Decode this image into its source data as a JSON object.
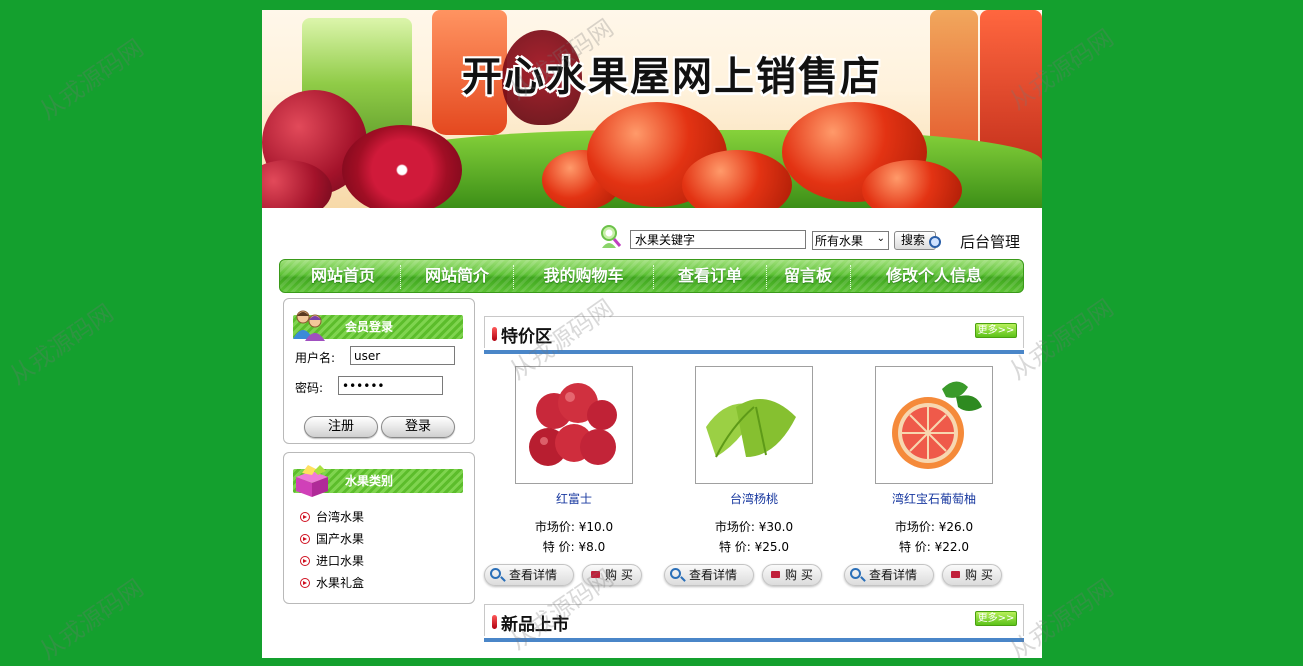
{
  "banner": {
    "title": "开心水果屋网上销售店"
  },
  "search": {
    "placeholder_value": "水果关键字",
    "category_selected": "所有水果",
    "button_label": "搜索",
    "admin_link": "后台管理"
  },
  "nav": {
    "items": [
      {
        "label": "网站首页"
      },
      {
        "label": "网站简介"
      },
      {
        "label": "我的购物车"
      },
      {
        "label": "查看订单"
      },
      {
        "label": "留言板"
      },
      {
        "label": "修改个人信息"
      }
    ]
  },
  "login": {
    "title": "会员登录",
    "username_label": "用户名:",
    "username_value": "user",
    "password_label": "密码:",
    "password_value": "••••••",
    "register_label": "注册",
    "login_label": "登录"
  },
  "categories": {
    "title": "水果类别",
    "items": [
      {
        "label": "台湾水果"
      },
      {
        "label": "国产水果"
      },
      {
        "label": "进口水果"
      },
      {
        "label": "水果礼盒"
      }
    ]
  },
  "specials": {
    "title": "特价区",
    "more_label": "更多>>",
    "products": [
      {
        "name": "红富士",
        "market_label": "市场价:",
        "market_price": "¥10.0",
        "special_label": "特 价:",
        "special_price": "¥8.0",
        "detail_label": "查看详情",
        "buy_label": "购 买"
      },
      {
        "name": "台湾杨桃",
        "market_label": "市场价:",
        "market_price": "¥30.0",
        "special_label": "特 价:",
        "special_price": "¥25.0",
        "detail_label": "查看详情",
        "buy_label": "购 买"
      },
      {
        "name": "湾红宝石葡萄柚",
        "market_label": "市场价:",
        "market_price": "¥26.0",
        "special_label": "特 价:",
        "special_price": "¥22.0",
        "detail_label": "查看详情",
        "buy_label": "购 买"
      }
    ]
  },
  "new_arrivals": {
    "title": "新品上市",
    "more_label": "更多>>"
  },
  "watermark": "从戎源码网",
  "colors": {
    "background": "#14a02e",
    "nav_green": "#5ec236",
    "section_bar": "#4a86c8",
    "product_link": "#1a3aa0"
  }
}
